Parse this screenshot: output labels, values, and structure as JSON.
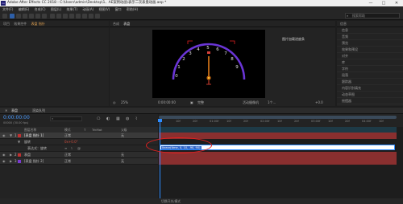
{
  "titlebar": {
    "app_icon": "Ae",
    "title": "Adobe After Effects CC 2018 - C:\\Users\\admin\\Desktop\\1、AE案例动画\\表示二次表盘动画.aep *",
    "minimize": "—",
    "maximize": "□",
    "close": "✕"
  },
  "menu": {
    "items": [
      "文件(F)",
      "编辑(E)",
      "合成(C)",
      "图层(L)",
      "效果(T)",
      "动画(A)",
      "视图(V)",
      "窗口",
      "帮助(H)"
    ]
  },
  "toolbar": {
    "tools": [
      "home-icon",
      "select-arrow-icon",
      "hand-icon",
      "zoom-icon",
      "rotate-icon",
      "camera-icon",
      "pan-behind-icon",
      "rectangle-icon",
      "pen-icon",
      "text-icon",
      "brush-icon",
      "clone-icon",
      "eraser-icon",
      "roto-icon",
      "puppet-icon"
    ],
    "search_label": "搜索帮助"
  },
  "left_panel": {
    "tabs": [
      "项目",
      "效果控件",
      "表盘 指针"
    ]
  },
  "comp_panel": {
    "tabs": [
      "合成",
      "表盘"
    ],
    "dial_numbers": [
      "0",
      "1",
      "2",
      "3",
      "4",
      "5",
      "6",
      "7",
      "8",
      "9"
    ],
    "footer": {
      "zoom": "25%",
      "timecode": "0:00:00:00",
      "quality": "完整",
      "camera": "活动摄像机",
      "views": "1个...",
      "exposure": "+0.0"
    },
    "title_tip": "活动摄像机"
  },
  "right_panel": {
    "header": "信息",
    "tip": "图片加载进度条",
    "items": [
      "信息",
      "音频",
      "预览",
      "效果和预设",
      "对齐",
      "库",
      "字符",
      "段落",
      "跟踪器",
      "内容识别填充",
      "动态草图",
      "摇摆器",
      "蒙版插值",
      "平滑器"
    ]
  },
  "timeline": {
    "tabs": [
      "表盘",
      "渲染队列"
    ],
    "timecode": "0:00:00:00",
    "fps": "00000 (30.00 fps)",
    "col_headers": [
      "图层名称",
      "模式",
      "T",
      "TrkMat",
      "父级"
    ],
    "layers": [
      {
        "num": "1",
        "name": "[表盘 指针 1]",
        "mode": "正常",
        "parent": "无"
      },
      {
        "num": "",
        "name": "旋转",
        "mode": "",
        "parent": ""
      },
      {
        "num": "",
        "name": "表达式：旋转",
        "mode": "",
        "parent": ""
      },
      {
        "num": "2",
        "name": "表盘",
        "mode": "正常",
        "parent": "无"
      },
      {
        "num": "3",
        "name": "[表盘 指针 2]",
        "mode": "正常",
        "parent": "无"
      }
    ],
    "rotation_value": "0x+0.0°",
    "expression_text": "linear(time, 0, 10, -90, 90)",
    "ruler_ticks": [
      "0f",
      "10f",
      "20f",
      "01:00f",
      "10f",
      "20f",
      "02:00f",
      "10f",
      "20f",
      "03:00f",
      "10f",
      "20f",
      "04:00f",
      "10f"
    ],
    "bottom_label": "切换开关/模式"
  },
  "colors": {
    "accent": "#2d8cff",
    "track_red": "#8a2f2f",
    "dial_purple": "#6a35d6",
    "needle_orange": "#e07a1a",
    "annotation_red": "#e02020"
  }
}
